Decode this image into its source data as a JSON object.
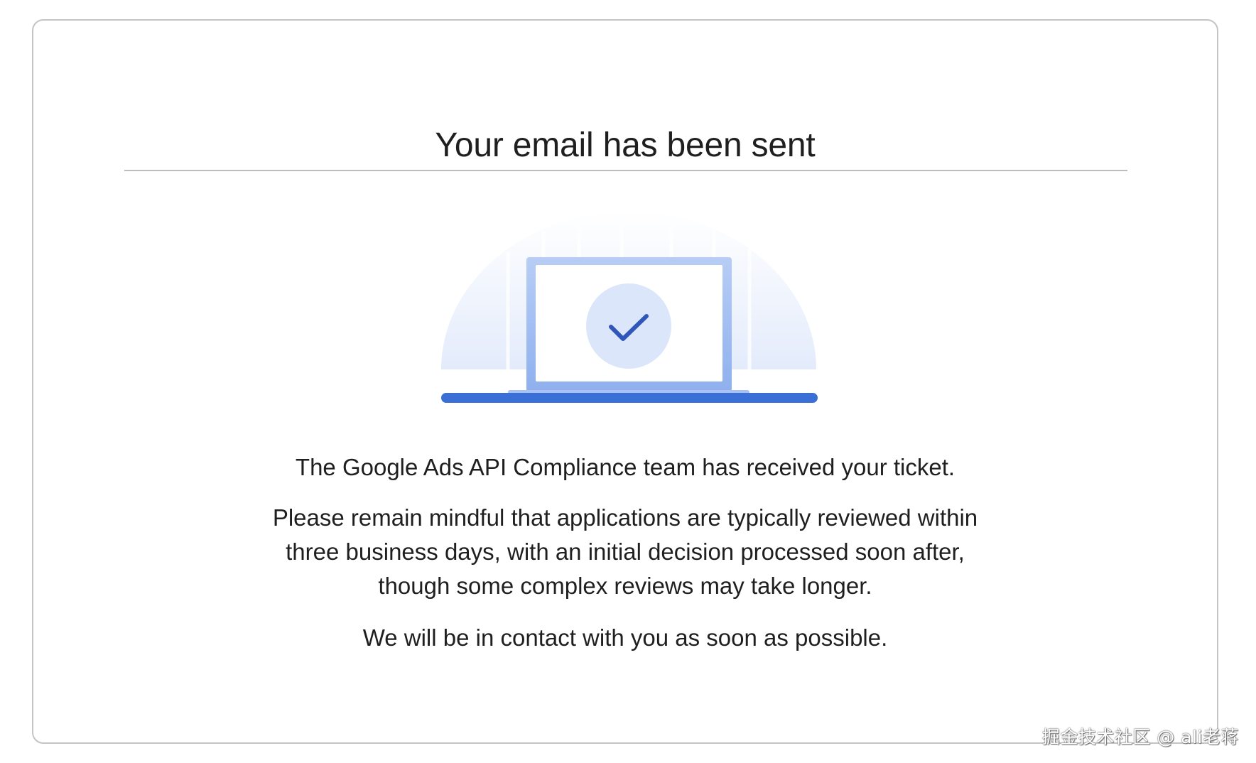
{
  "dialog": {
    "title": "Your email has been sent",
    "illustration_icon": "laptop-checkmark-icon",
    "messages": [
      "The Google Ads API Compliance team has received your ticket.",
      "Please remain mindful that applications are typically reviewed within three business days, with an initial decision processed soon after, though some complex reviews may take longer.",
      "We will be in contact with you as soon as possible."
    ]
  },
  "watermark": "掘金技术社区 @ ali老蒋",
  "colors": {
    "accent_blue": "#3b6fd8",
    "laptop_frame": "#a9c2f2",
    "check_circle": "#dbe6fb",
    "check_mark": "#2f56b8",
    "glow": "#eef3fd"
  }
}
